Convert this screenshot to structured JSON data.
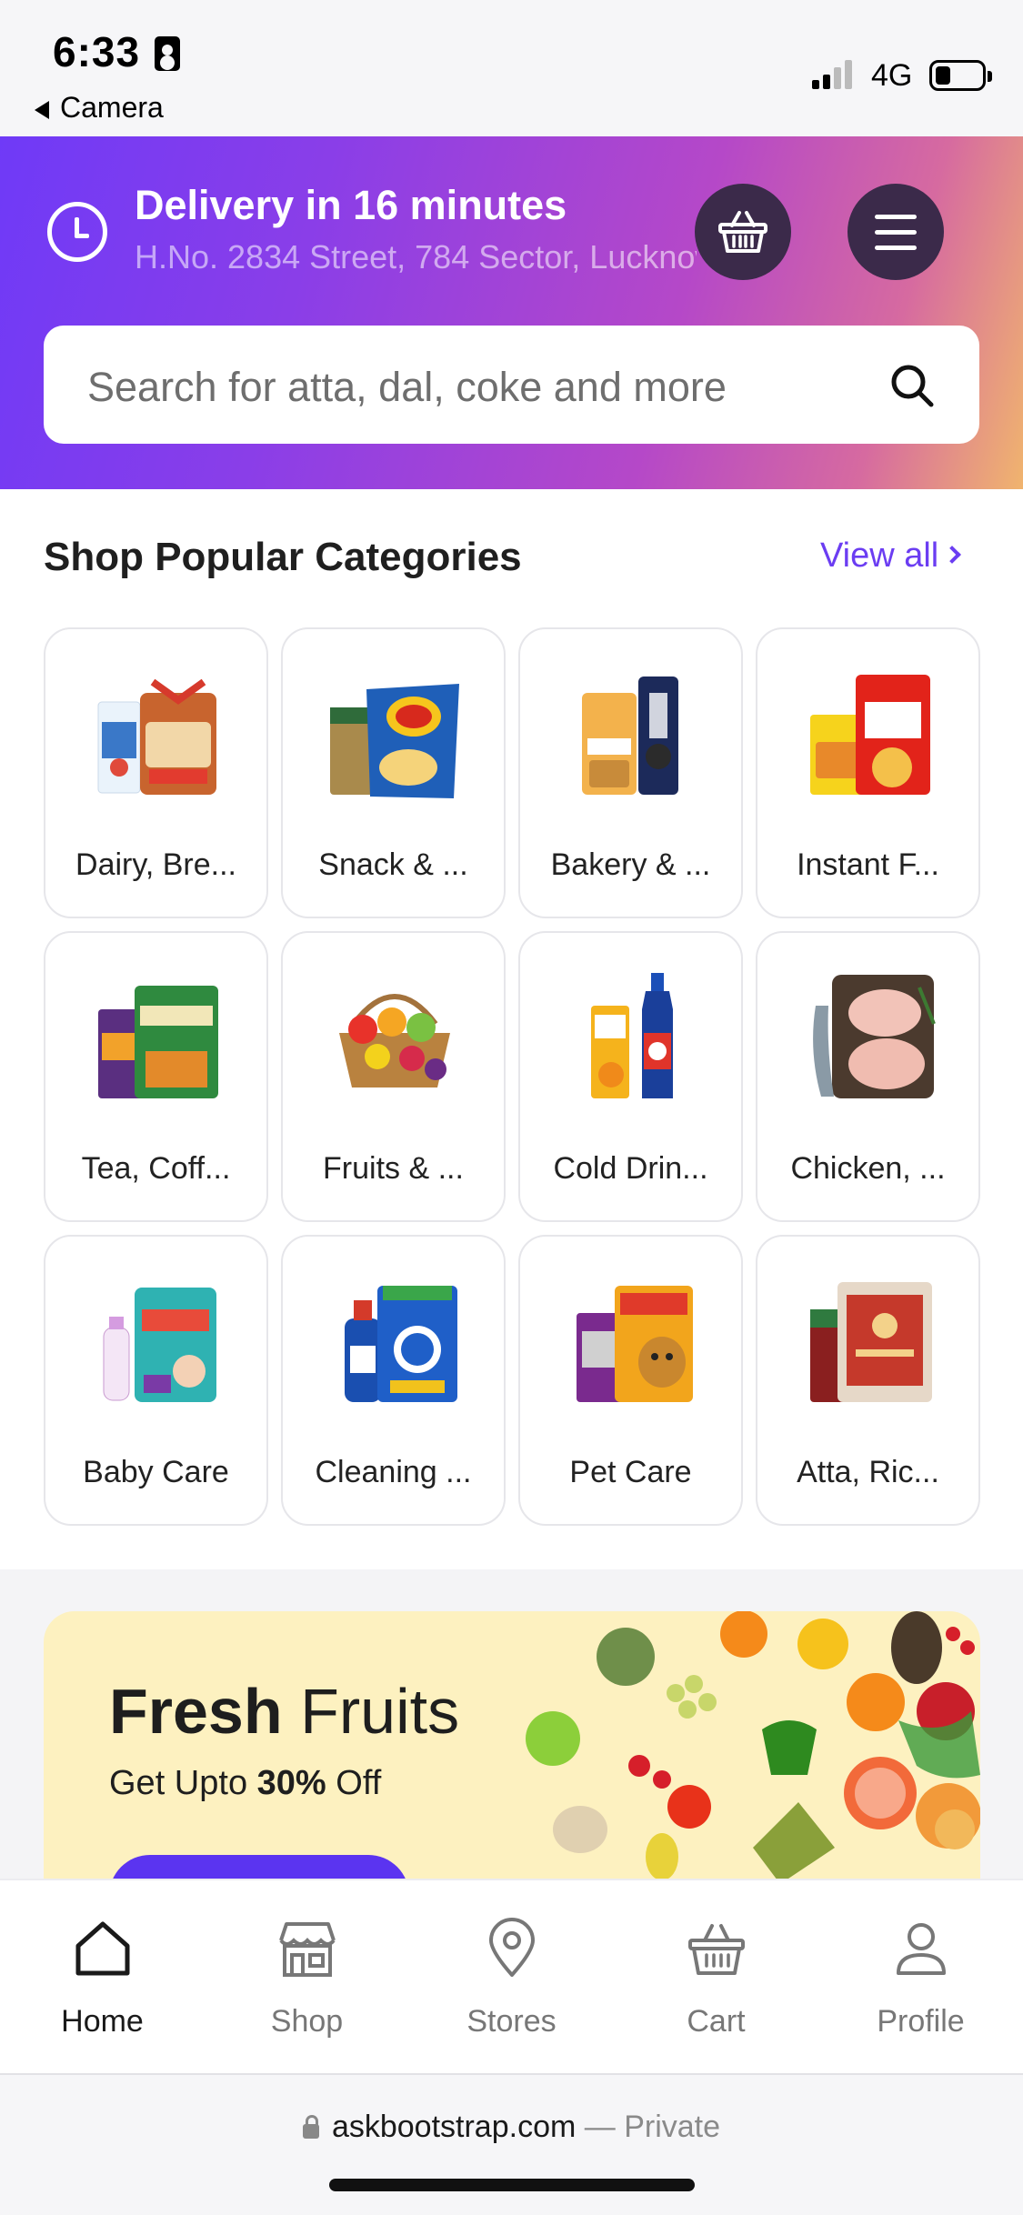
{
  "status_bar": {
    "time": "6:33",
    "back_label": "Camera",
    "network": "4G"
  },
  "header": {
    "delivery_title": "Delivery in 16 minutes",
    "address": "H.No. 2834 Street, 784 Sector, Lucknow",
    "basket_icon": "basket-icon",
    "menu_icon": "hamburger-menu-icon"
  },
  "search": {
    "placeholder": "Search for atta, dal, coke and more",
    "icon": "search-icon"
  },
  "categories": {
    "title": "Shop Popular Categories",
    "view_all": "View all",
    "items": [
      {
        "label": "Dairy, Bre...",
        "icon": "dairy-bread-icon"
      },
      {
        "label": "Snack & ...",
        "icon": "snack-icon"
      },
      {
        "label": "Bakery & ...",
        "icon": "bakery-icon"
      },
      {
        "label": "Instant F...",
        "icon": "instant-food-icon"
      },
      {
        "label": "Tea, Coff...",
        "icon": "tea-coffee-icon"
      },
      {
        "label": "Fruits & ...",
        "icon": "fruits-icon"
      },
      {
        "label": "Cold Drin...",
        "icon": "cold-drinks-icon"
      },
      {
        "label": "Chicken, ...",
        "icon": "chicken-icon"
      },
      {
        "label": "Baby Care",
        "icon": "baby-care-icon"
      },
      {
        "label": "Cleaning ...",
        "icon": "cleaning-icon"
      },
      {
        "label": "Pet Care",
        "icon": "pet-care-icon"
      },
      {
        "label": "Atta, Ric...",
        "icon": "atta-rice-icon"
      }
    ]
  },
  "banner": {
    "title_bold": "Fresh",
    "title_rest": " Fruits",
    "sub_prefix": "Get Upto ",
    "sub_bold": "30%",
    "sub_suffix": " Off"
  },
  "bottom_nav": {
    "items": [
      {
        "label": "Home",
        "icon": "home-icon",
        "active": true
      },
      {
        "label": "Shop",
        "icon": "shop-icon",
        "active": false
      },
      {
        "label": "Stores",
        "icon": "location-pin-icon",
        "active": false
      },
      {
        "label": "Cart",
        "icon": "cart-basket-icon",
        "active": false
      },
      {
        "label": "Profile",
        "icon": "user-icon",
        "active": false
      }
    ]
  },
  "browser": {
    "domain": "askbootstrap.com",
    "separator": " — ",
    "mode": "Private"
  },
  "colors": {
    "accent": "#6b3df2",
    "header_gradient_start": "#6f3af7",
    "header_gradient_end": "#f0b46e",
    "banner_bg": "#fdf1c0",
    "header_button_bg": "#3b2a4a"
  }
}
